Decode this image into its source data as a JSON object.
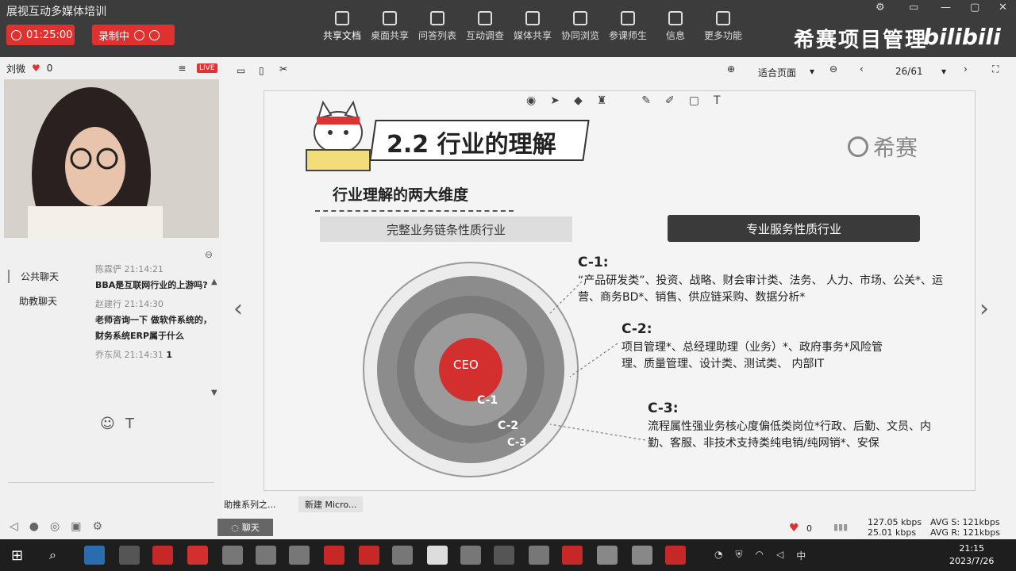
{
  "app": {
    "title": "展视互动多媒体培训",
    "timer": "01:25:00",
    "record_label": "录制中"
  },
  "toolbar": {
    "items": [
      "共享文档",
      "桌面共享",
      "问答列表",
      "互动调查",
      "媒体共享",
      "协同浏览",
      "参课师生",
      "信息",
      "更多功能"
    ]
  },
  "brand": {
    "name": "希赛项目管理",
    "site": "bilibili"
  },
  "user": {
    "name": "刘微",
    "likes": "0",
    "live_badge": "LIVE"
  },
  "chat": {
    "tabs": [
      "公共聊天",
      "助教聊天"
    ],
    "messages": [
      {
        "author": "陈霖俨",
        "time": "21:14:21",
        "text": "BBA是互联网行业的上游吗?"
      },
      {
        "author": "赵建行",
        "time": "21:14:30",
        "text": "老师咨询一下 做软件系统的，财务系统ERP属于什么"
      },
      {
        "author": "乔东风",
        "time": "21:14:31",
        "text": "1"
      }
    ]
  },
  "doc": {
    "zoom": "适合页面",
    "page": "26/61"
  },
  "slide": {
    "title": "2.2 行业的理解",
    "logo_text": "希赛",
    "subtitle": "行业理解的两大维度",
    "tag_left": "完整业务链条性质行业",
    "tag_right": "专业服务性质行业",
    "circles": [
      "CEO",
      "C-1",
      "C-2",
      "C-3"
    ],
    "c1_head": "C-1:",
    "c1_text": "“产品研发类”、投资、战略、财会审计类、法务、 人力、市场、公关*、运营、商务BD*、销售、供应链采购、数据分析*",
    "c2_head": "C-2:",
    "c2_text": "项目管理*、总经理助理（业务）*、政府事务*风险管理、质量管理、设计类、测试类、 内部IT",
    "c3_head": "C-3:",
    "c3_text": "流程属性强业务核心度偏低类岗位*行政、后勤、文员、内勤、客服、非技术支持类纯电销/纯网销*、安保"
  },
  "bottom": {
    "tabs": [
      "助推系列之...",
      "新建 Micro..."
    ],
    "chat_button": "聊天",
    "likes": "0",
    "up": "127.05 kbps",
    "down": "25.01 kbps",
    "avg_s": "AVG S: 121kbps",
    "avg_r": "AVG R: 121kbps"
  },
  "taskbar": {
    "time": "21:15",
    "date": "2023/7/26",
    "ime": "中"
  },
  "colors": {
    "accent": "#e03131",
    "dark": "#3c3c3c"
  }
}
